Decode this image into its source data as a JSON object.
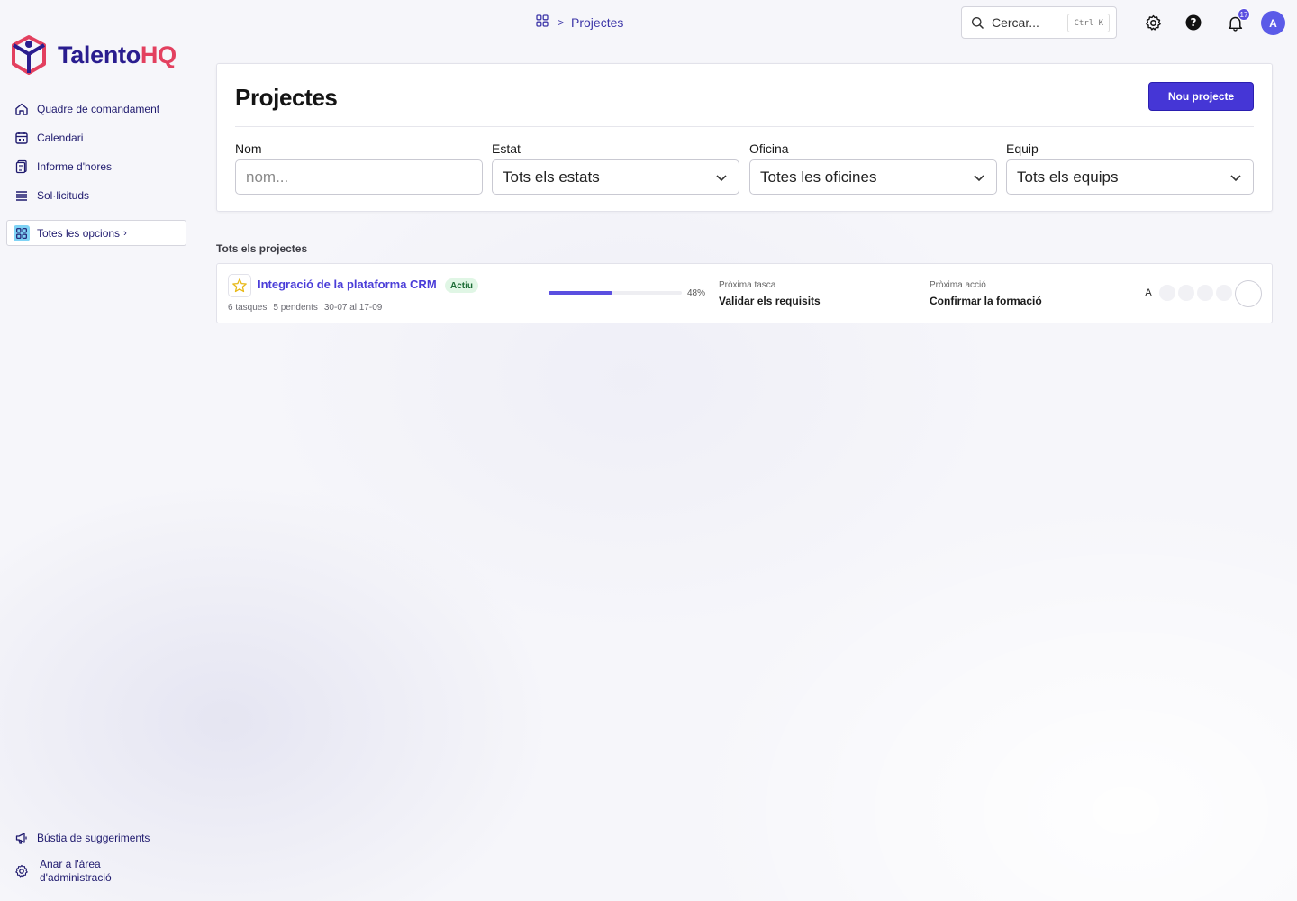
{
  "brand": {
    "name_part1": "Talento",
    "name_part2": "HQ"
  },
  "sidebar": {
    "items": [
      {
        "label": "Quadre de comandament",
        "icon": "home-icon"
      },
      {
        "label": "Calendari",
        "icon": "calendar-icon"
      },
      {
        "label": "Informe d'hores",
        "icon": "report-icon"
      },
      {
        "label": "Sol·licituds",
        "icon": "list-icon"
      }
    ],
    "all_options_label": "Totes les opcions",
    "bottom": {
      "suggestions_label": "Bústia de suggeriments",
      "admin_line1": "Anar a l'àrea",
      "admin_line2": "d'administració"
    }
  },
  "topbar": {
    "breadcrumb_current": "Projectes",
    "search_placeholder": "Cercar...",
    "search_shortcut": "Ctrl K",
    "notification_count": "17",
    "avatar_initial": "A"
  },
  "header": {
    "title": "Projectes",
    "new_button_label": "Nou projecte",
    "filters": [
      {
        "label": "Nom",
        "placeholder": "nom..."
      },
      {
        "label": "Estat",
        "value": "Tots els estats"
      },
      {
        "label": "Oficina",
        "value": "Totes les oficines"
      },
      {
        "label": "Equip",
        "value": "Tots els equips"
      }
    ]
  },
  "projects": {
    "section_title": "Tots els projectes",
    "rows": [
      {
        "name": "Integració de la plataforma CRM",
        "status": "Actiu",
        "tasks": "6 tasques",
        "pending": "5 pendents",
        "dates": "30-07 al 17-09",
        "progress": 48,
        "progress_text": "48%",
        "next_task_label": "Pròxima tasca",
        "next_task": "Validar els requisits",
        "next_action_label": "Pròxima acció",
        "next_action": "Confirmar la formació",
        "member_initial": "A"
      }
    ]
  },
  "colors": {
    "accent": "#4536d6",
    "brand_dark": "#2a1d8f",
    "brand_pink": "#e3405f",
    "status_green_bg": "#e0f6e5"
  }
}
